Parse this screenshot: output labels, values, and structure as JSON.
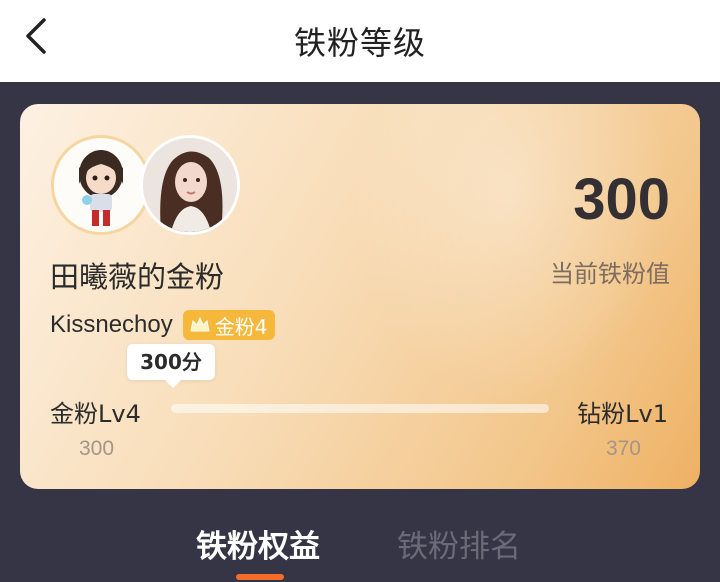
{
  "header": {
    "title": "铁粉等级"
  },
  "card": {
    "fan_name": "田曦薇的金粉",
    "score": "300",
    "score_label": "当前铁粉值",
    "username": "Kissnechoy",
    "badge": "金粉4",
    "tooltip": "300分",
    "progress": 0.0,
    "level_current": "金粉Lv4",
    "level_next": "钻粉Lv1",
    "value_current": "300",
    "value_next": "370"
  },
  "tabs": [
    {
      "label": "铁粉权益",
      "active": true
    },
    {
      "label": "铁粉排名",
      "active": false
    }
  ],
  "colors": {
    "accent": "#f36c2a",
    "badge": "#f5b83a",
    "background": "#363545"
  },
  "icons": [
    "back-arrow-icon",
    "crown-icon"
  ]
}
